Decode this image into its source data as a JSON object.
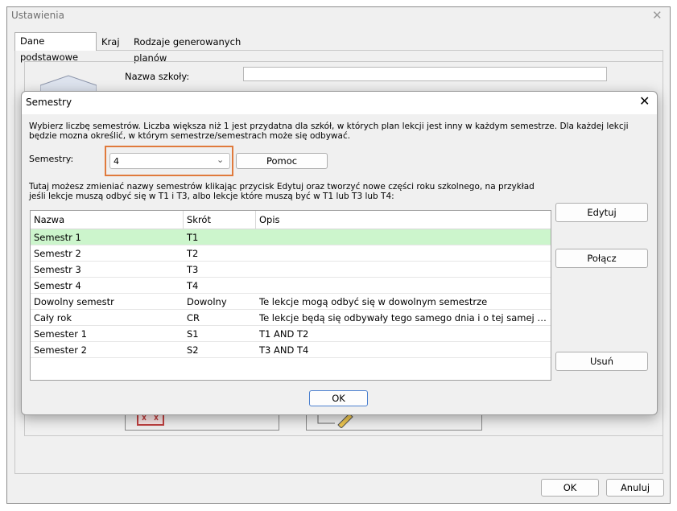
{
  "outer_window": {
    "title": "Ustawienia",
    "close_glyph": "✕",
    "tabs": [
      "Dane podstawowe",
      "Kraj",
      "Rodzaje generowanych planów"
    ],
    "school_name_label": "Nazwa szkoły:",
    "school_name_value": "",
    "ok_label": "OK",
    "cancel_label": "Anuluj"
  },
  "dialog": {
    "title": "Semestry",
    "close_glyph": "✕",
    "description1": "Wybierz liczbę semestrów. Liczba większa niż 1 jest przydatna dla szkół, w których plan lekcji jest inny w każdym semestrze. Dla każdej lekcji będzie mozna określić, w którym semestrze/semestrach może się odbywać.",
    "semesters_label": "Semestry:",
    "semesters_value": "4",
    "help_label": "Pomoc",
    "description2": "Tutaj możesz zmieniać nazwy semestrów klikając przycisk Edytuj oraz tworzyć nowe części roku szkolnego, na przykład jeśli lekcje muszą odbyć się w T1 i T3, albo lekcje które muszą być w T1 lub T3 lub T4:",
    "columns": {
      "name": "Nazwa",
      "abbr": "Skrót",
      "desc": "Opis"
    },
    "rows": [
      {
        "name": "Semestr 1",
        "abbr": "T1",
        "desc": ""
      },
      {
        "name": "Semestr 2",
        "abbr": "T2",
        "desc": ""
      },
      {
        "name": "Semestr 3",
        "abbr": "T3",
        "desc": ""
      },
      {
        "name": "Semestr 4",
        "abbr": "T4",
        "desc": ""
      },
      {
        "name": "Dowolny semestr",
        "abbr": "Dowolny",
        "desc": "Te lekcje mogą odbyć się w dowolnym semestrze"
      },
      {
        "name": "Cały rok",
        "abbr": "CR",
        "desc": "Te lekcje będą się odbywały tego samego dnia i o tej samej godzin..."
      },
      {
        "name": "Semester 1",
        "abbr": "S1",
        "desc": "T1 AND T2"
      },
      {
        "name": "Semester 2",
        "abbr": "S2",
        "desc": "T3 AND T4"
      }
    ],
    "edit_label": "Edytuj",
    "join_label": "Połącz",
    "delete_label": "Usuń",
    "ok_label": "OK"
  },
  "colors": {
    "selected_row": "#ccf5cc",
    "highlight_box": "#e07a3c",
    "default_button_border": "#4a7fcf"
  },
  "icons": [
    "house-icon",
    "close-icon",
    "chevron-down-icon",
    "calendar-icon",
    "pencil-icon"
  ]
}
